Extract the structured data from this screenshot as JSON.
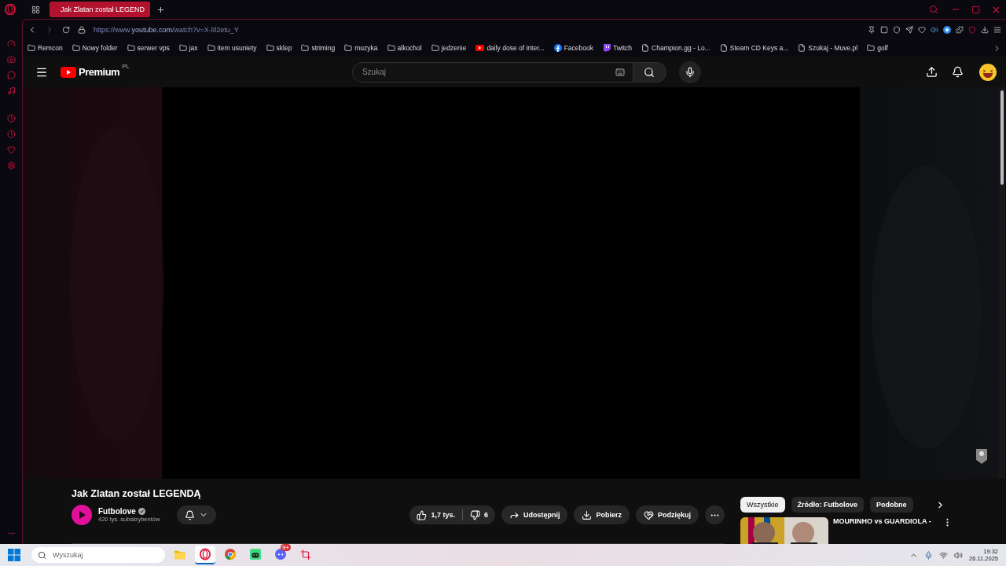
{
  "browser": {
    "tab": {
      "title": "Jak Zlatan został LEGEND",
      "selected": true
    },
    "url": {
      "scheme": "https://www.",
      "domain": "youtube.com",
      "path": "/watch?v=X-lIl2etu_Y"
    },
    "bookmarks": [
      {
        "kind": "folder",
        "label": "Remcon"
      },
      {
        "kind": "folder",
        "label": "Nowy folder"
      },
      {
        "kind": "folder",
        "label": "serwer vps"
      },
      {
        "kind": "folder",
        "label": "jax"
      },
      {
        "kind": "folder",
        "label": "item usuniety"
      },
      {
        "kind": "folder",
        "label": "sklep"
      },
      {
        "kind": "folder",
        "label": "striming"
      },
      {
        "kind": "folder",
        "label": "muzyka"
      },
      {
        "kind": "folder",
        "label": "alkochol"
      },
      {
        "kind": "folder",
        "label": "jedzenie"
      },
      {
        "kind": "youtube",
        "label": "daily dose of inter..."
      },
      {
        "kind": "facebook",
        "label": "Facebook"
      },
      {
        "kind": "twitch",
        "label": "Twitch"
      },
      {
        "kind": "page",
        "label": "Champion.gg - Lo..."
      },
      {
        "kind": "page",
        "label": "Steam CD Keys a..."
      },
      {
        "kind": "page",
        "label": "Szukaj - Muve.pl"
      },
      {
        "kind": "folder",
        "label": "golf"
      }
    ]
  },
  "youtube": {
    "logo": "Premium",
    "region": "PL",
    "search": {
      "placeholder": "Szukaj"
    },
    "video": {
      "kind": "picture",
      "title": "Jak Zlatan został LEGENDĄ"
    },
    "channel": {
      "name": "Futbolove",
      "subscribers": "420 tys. subskrybentów"
    },
    "actions": {
      "likes": "1,7 tys.",
      "dislikes": "6",
      "share": "Udostępnij",
      "download": "Pobierz",
      "thanks": "Podziękuj"
    },
    "chips": [
      {
        "label": "Wszystkie",
        "selected": true
      },
      {
        "label": "Źródło: Futbolove",
        "selected": false
      },
      {
        "label": "Podobne",
        "selected": false
      }
    ],
    "related": [
      {
        "title": "MOURINHO vs GUARDIOLA -"
      }
    ]
  },
  "taskbar": {
    "search": {
      "placeholder": "Wyszukaj"
    },
    "apps": [
      {
        "kind": "files",
        "active": false
      },
      {
        "kind": "opera",
        "active": true
      },
      {
        "kind": "chrome",
        "active": false
      },
      {
        "kind": "android",
        "active": false
      },
      {
        "kind": "discord",
        "active": false,
        "badge": "9+"
      },
      {
        "kind": "snip",
        "active": false
      }
    ],
    "time": "19:32",
    "date": "26.11.2025"
  }
}
